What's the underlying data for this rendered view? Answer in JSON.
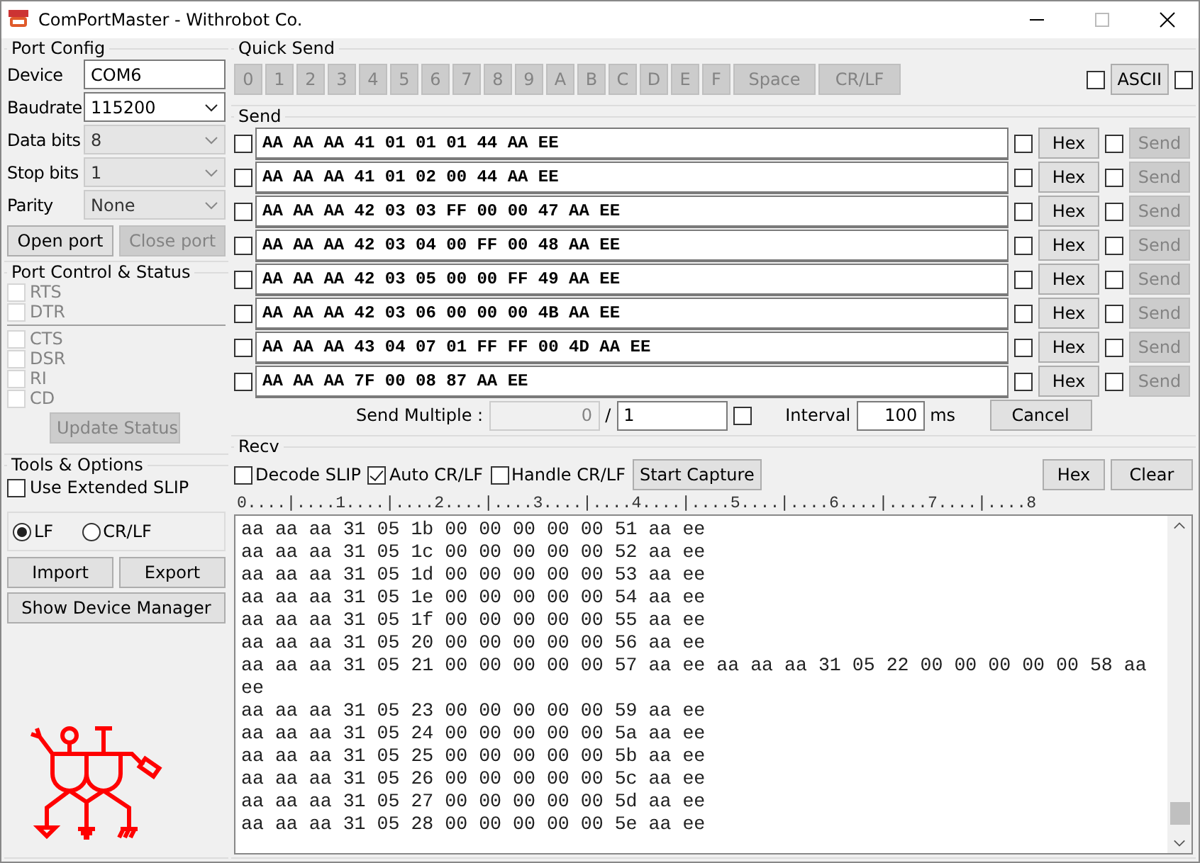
{
  "window": {
    "title": "ComPortMaster - Withrobot Co."
  },
  "port_config": {
    "title": "Port Config",
    "fields": [
      {
        "label": "Device",
        "kind": "input",
        "value": "COM6",
        "disabled": false
      },
      {
        "label": "Baudrate",
        "kind": "select",
        "value": "115200",
        "disabled": false
      },
      {
        "label": "Data bits",
        "kind": "select",
        "value": "8",
        "disabled": true
      },
      {
        "label": "Stop bits",
        "kind": "select",
        "value": "1",
        "disabled": true
      },
      {
        "label": "Parity",
        "kind": "select",
        "value": "None",
        "disabled": true
      }
    ],
    "buttons": [
      {
        "label": "Open port",
        "disabled": false
      },
      {
        "label": "Close port",
        "disabled": true
      }
    ]
  },
  "port_control": {
    "title": "Port Control & Status",
    "outputs": [
      {
        "label": "RTS",
        "checked": false,
        "disabled": true
      },
      {
        "label": "DTR",
        "checked": false,
        "disabled": true
      }
    ],
    "inputs": [
      {
        "label": "CTS",
        "checked": false,
        "disabled": true
      },
      {
        "label": "DSR",
        "checked": false,
        "disabled": true
      },
      {
        "label": "RI",
        "checked": false,
        "disabled": true
      },
      {
        "label": "CD",
        "checked": false,
        "disabled": true
      }
    ],
    "update_button": {
      "label": "Update Status",
      "disabled": true
    }
  },
  "tools": {
    "title": "Tools & Options",
    "extended_slip": {
      "label": "Use Extended SLIP",
      "checked": false
    },
    "line_ending": [
      {
        "label": "LF",
        "selected": true
      },
      {
        "label": "CR/LF",
        "selected": false
      }
    ],
    "buttons": [
      {
        "label": "Import"
      },
      {
        "label": "Export"
      }
    ],
    "device_manager_button": {
      "label": "Show Device Manager"
    }
  },
  "quick_send": {
    "title": "Quick Send",
    "keys": [
      {
        "label": "0",
        "disabled": true
      },
      {
        "label": "1",
        "disabled": true
      },
      {
        "label": "2",
        "disabled": true
      },
      {
        "label": "3",
        "disabled": true
      },
      {
        "label": "4",
        "disabled": true
      },
      {
        "label": "5",
        "disabled": true
      },
      {
        "label": "6",
        "disabled": true
      },
      {
        "label": "7",
        "disabled": true
      },
      {
        "label": "8",
        "disabled": true
      },
      {
        "label": "9",
        "disabled": true
      },
      {
        "label": "A",
        "disabled": true
      },
      {
        "label": "B",
        "disabled": true
      },
      {
        "label": "C",
        "disabled": true
      },
      {
        "label": "D",
        "disabled": true
      },
      {
        "label": "E",
        "disabled": true
      },
      {
        "label": "F",
        "disabled": true
      },
      {
        "label": "Space",
        "disabled": true
      },
      {
        "label": "CR/LF",
        "disabled": true
      }
    ],
    "left_checked": false,
    "ascii_label": "ASCII",
    "right_checked": false
  },
  "send": {
    "title": "Send",
    "rows": [
      {
        "checked": false,
        "value": "AA AA AA 41 01 01 01 44 AA EE",
        "hex_checked": false,
        "hex_label": "Hex",
        "send_checked": false,
        "send_label": "Send",
        "send_disabled": true
      },
      {
        "checked": false,
        "value": "AA AA AA 41 01 02 00 44 AA EE",
        "hex_checked": false,
        "hex_label": "Hex",
        "send_checked": false,
        "send_label": "Send",
        "send_disabled": true
      },
      {
        "checked": false,
        "value": "AA AA AA 42 03 03 FF 00 00 47 AA EE",
        "hex_checked": false,
        "hex_label": "Hex",
        "send_checked": false,
        "send_label": "Send",
        "send_disabled": true
      },
      {
        "checked": false,
        "value": "AA AA AA 42 03 04 00 FF 00 48 AA EE",
        "hex_checked": false,
        "hex_label": "Hex",
        "send_checked": false,
        "send_label": "Send",
        "send_disabled": true
      },
      {
        "checked": false,
        "value": "AA AA AA 42 03 05 00 00 FF 49 AA EE",
        "hex_checked": false,
        "hex_label": "Hex",
        "send_checked": false,
        "send_label": "Send",
        "send_disabled": true
      },
      {
        "checked": false,
        "value": "AA AA AA 42 03 06 00 00 00 4B AA EE",
        "hex_checked": false,
        "hex_label": "Hex",
        "send_checked": false,
        "send_label": "Send",
        "send_disabled": true
      },
      {
        "checked": false,
        "value": "AA AA AA 43 04 07 01 FF FF 00 4D AA EE",
        "hex_checked": false,
        "hex_label": "Hex",
        "send_checked": false,
        "send_label": "Send",
        "send_disabled": true
      },
      {
        "checked": false,
        "value": "AA AA AA 7F 00 08 87 AA EE",
        "hex_checked": false,
        "hex_label": "Hex",
        "send_checked": false,
        "send_label": "Send",
        "send_disabled": true
      }
    ],
    "multiple_label": "Send Multiple :",
    "multiple_count": "0",
    "separator": "/",
    "multiple_total": "1",
    "multiple_checked": false,
    "interval_label": "Interval",
    "interval_value": "100",
    "interval_unit": "ms",
    "cancel_label": "Cancel"
  },
  "recv": {
    "title": "Recv",
    "options": [
      {
        "label": "Decode SLIP",
        "checked": false
      },
      {
        "label": "Auto CR/LF",
        "checked": true
      },
      {
        "label": "Handle CR/LF",
        "checked": false
      }
    ],
    "capture_label": "Start Capture",
    "hex_label": "Hex",
    "clear_label": "Clear",
    "ruler": "0....|....1....|....2....|....3....|....4....|....5....|....6....|....7....|....8",
    "lines": [
      "aa aa aa 31 05 1b 00 00 00 00 00 51 aa ee",
      "aa aa aa 31 05 1c 00 00 00 00 00 52 aa ee",
      "aa aa aa 31 05 1d 00 00 00 00 00 53 aa ee",
      "aa aa aa 31 05 1e 00 00 00 00 00 54 aa ee",
      "aa aa aa 31 05 1f 00 00 00 00 00 55 aa ee",
      "aa aa aa 31 05 20 00 00 00 00 00 56 aa ee",
      "aa aa aa 31 05 21 00 00 00 00 00 57 aa ee aa aa aa 31 05 22 00 00 00 00 00 58 aa",
      "ee",
      "aa aa aa 31 05 23 00 00 00 00 00 59 aa ee",
      "aa aa aa 31 05 24 00 00 00 00 00 5a aa ee",
      "aa aa aa 31 05 25 00 00 00 00 00 5b aa ee",
      "aa aa aa 31 05 26 00 00 00 00 00 5c aa ee",
      "aa aa aa 31 05 27 00 00 00 00 00 5d aa ee",
      "aa aa aa 31 05 28 00 00 00 00 00 5e aa ee"
    ]
  }
}
